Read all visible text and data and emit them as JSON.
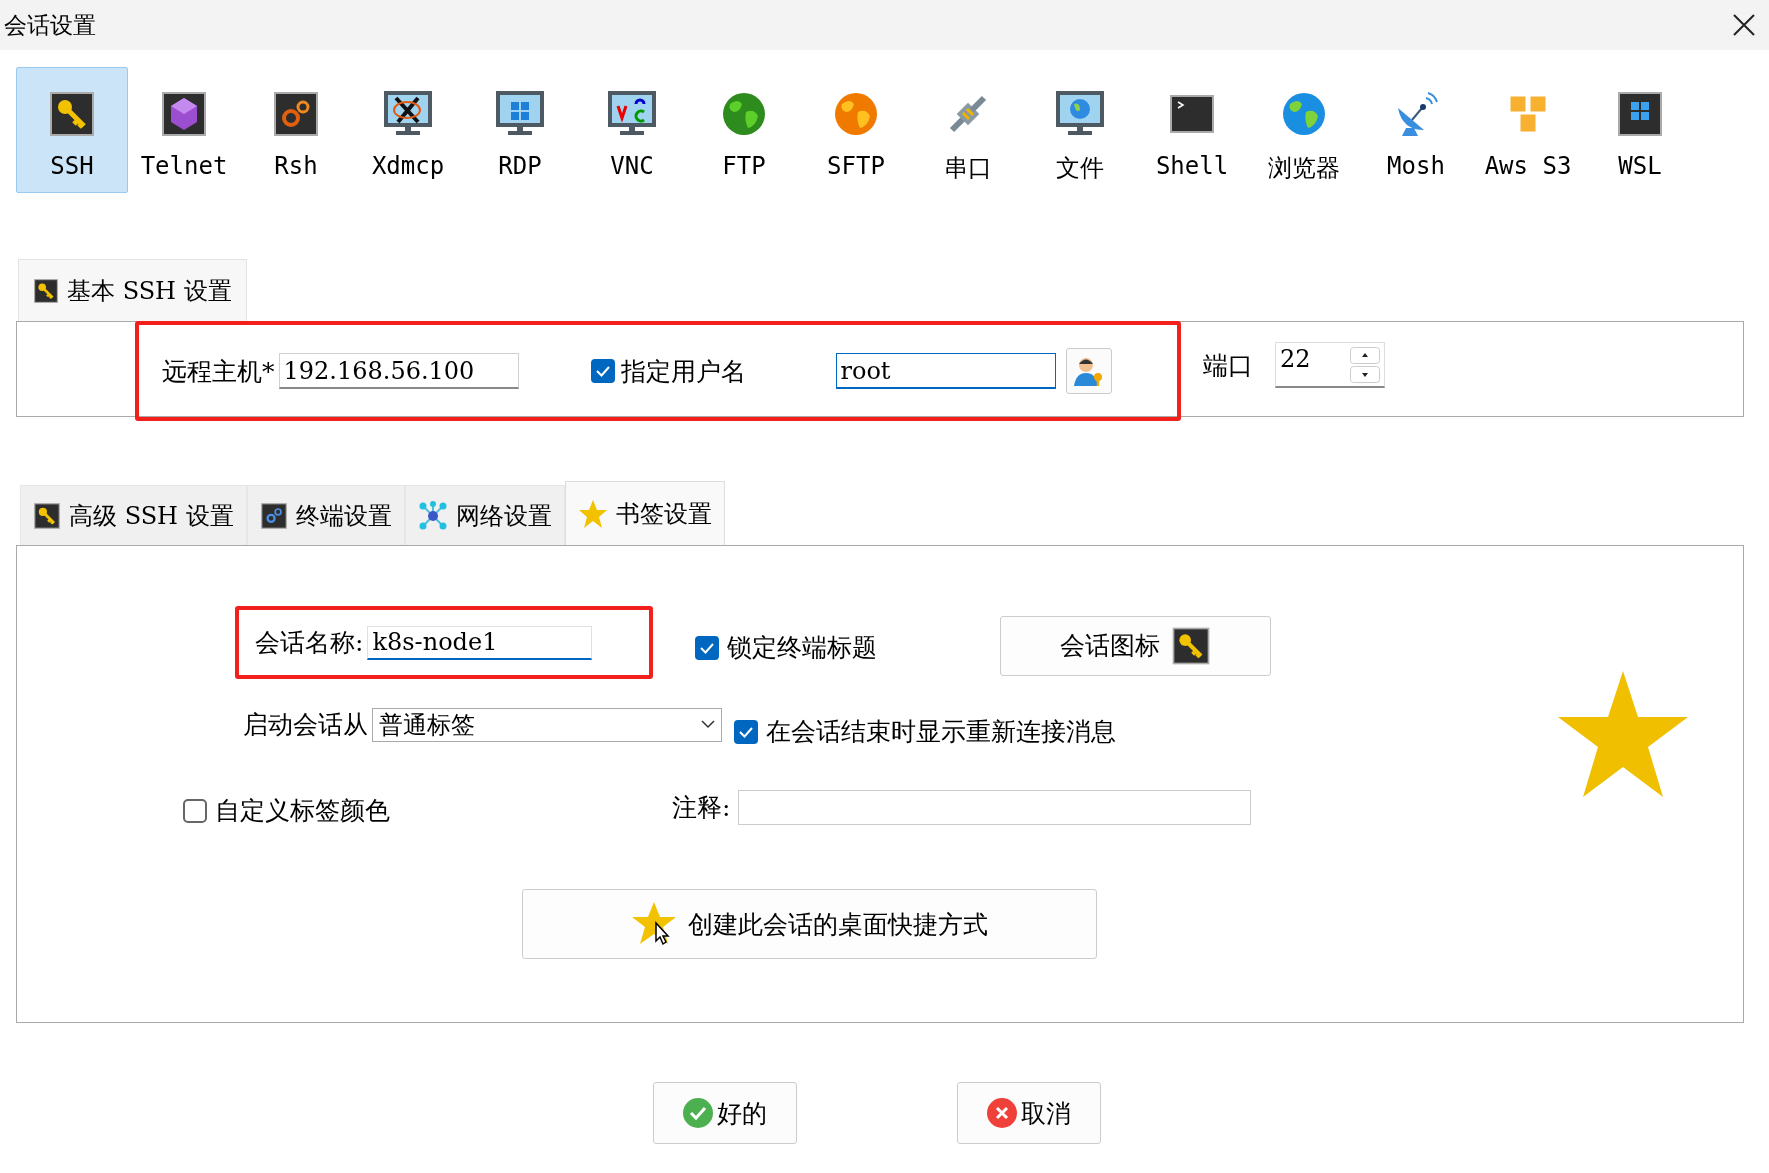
{
  "window": {
    "title": "会话设置"
  },
  "protocols": [
    {
      "label": "SSH",
      "selected": true
    },
    {
      "label": "Telnet",
      "selected": false
    },
    {
      "label": "Rsh",
      "selected": false
    },
    {
      "label": "Xdmcp",
      "selected": false
    },
    {
      "label": "RDP",
      "selected": false
    },
    {
      "label": "VNC",
      "selected": false
    },
    {
      "label": "FTP",
      "selected": false
    },
    {
      "label": "SFTP",
      "selected": false
    },
    {
      "label": "串口",
      "selected": false
    },
    {
      "label": "文件",
      "selected": false
    },
    {
      "label": "Shell",
      "selected": false
    },
    {
      "label": "浏览器",
      "selected": false
    },
    {
      "label": "Mosh",
      "selected": false
    },
    {
      "label": "Aws S3",
      "selected": false
    },
    {
      "label": "WSL",
      "selected": false
    }
  ],
  "basic_section": {
    "tab": "基本 SSH 设置",
    "highlighted": true,
    "remote_host": {
      "label": "远程主机*",
      "value": "192.168.56.100"
    },
    "specify_username": {
      "label": "指定用户名",
      "checked": true
    },
    "username": {
      "value": "root"
    },
    "port": {
      "label": "端口",
      "value": "22"
    }
  },
  "tabs": [
    {
      "label": "高级 SSH 设置",
      "selected": false
    },
    {
      "label": "终端设置",
      "selected": false
    },
    {
      "label": "网络设置",
      "selected": false
    },
    {
      "label": "书签设置",
      "selected": true
    }
  ],
  "bookmark": {
    "session_name": {
      "label": "会话名称:",
      "value": "k8s-node1",
      "highlighted": true
    },
    "lock_title": {
      "label": "锁定终端标题",
      "checked": true
    },
    "session_icon_button": "会话图标",
    "start_from": {
      "label": "启动会话从",
      "value": "普通标签"
    },
    "reconnect_message": {
      "label": "在会话结束时显示重新连接消息",
      "checked": true
    },
    "custom_color": {
      "label": "自定义标签颜色",
      "checked": false
    },
    "comment": {
      "label": "注释:"
    },
    "shortcut_button": "创建此会话的桌面快捷方式"
  },
  "buttons": [
    {
      "label": "好的",
      "kind": "ok"
    },
    {
      "label": "取消",
      "kind": "cancel"
    }
  ]
}
